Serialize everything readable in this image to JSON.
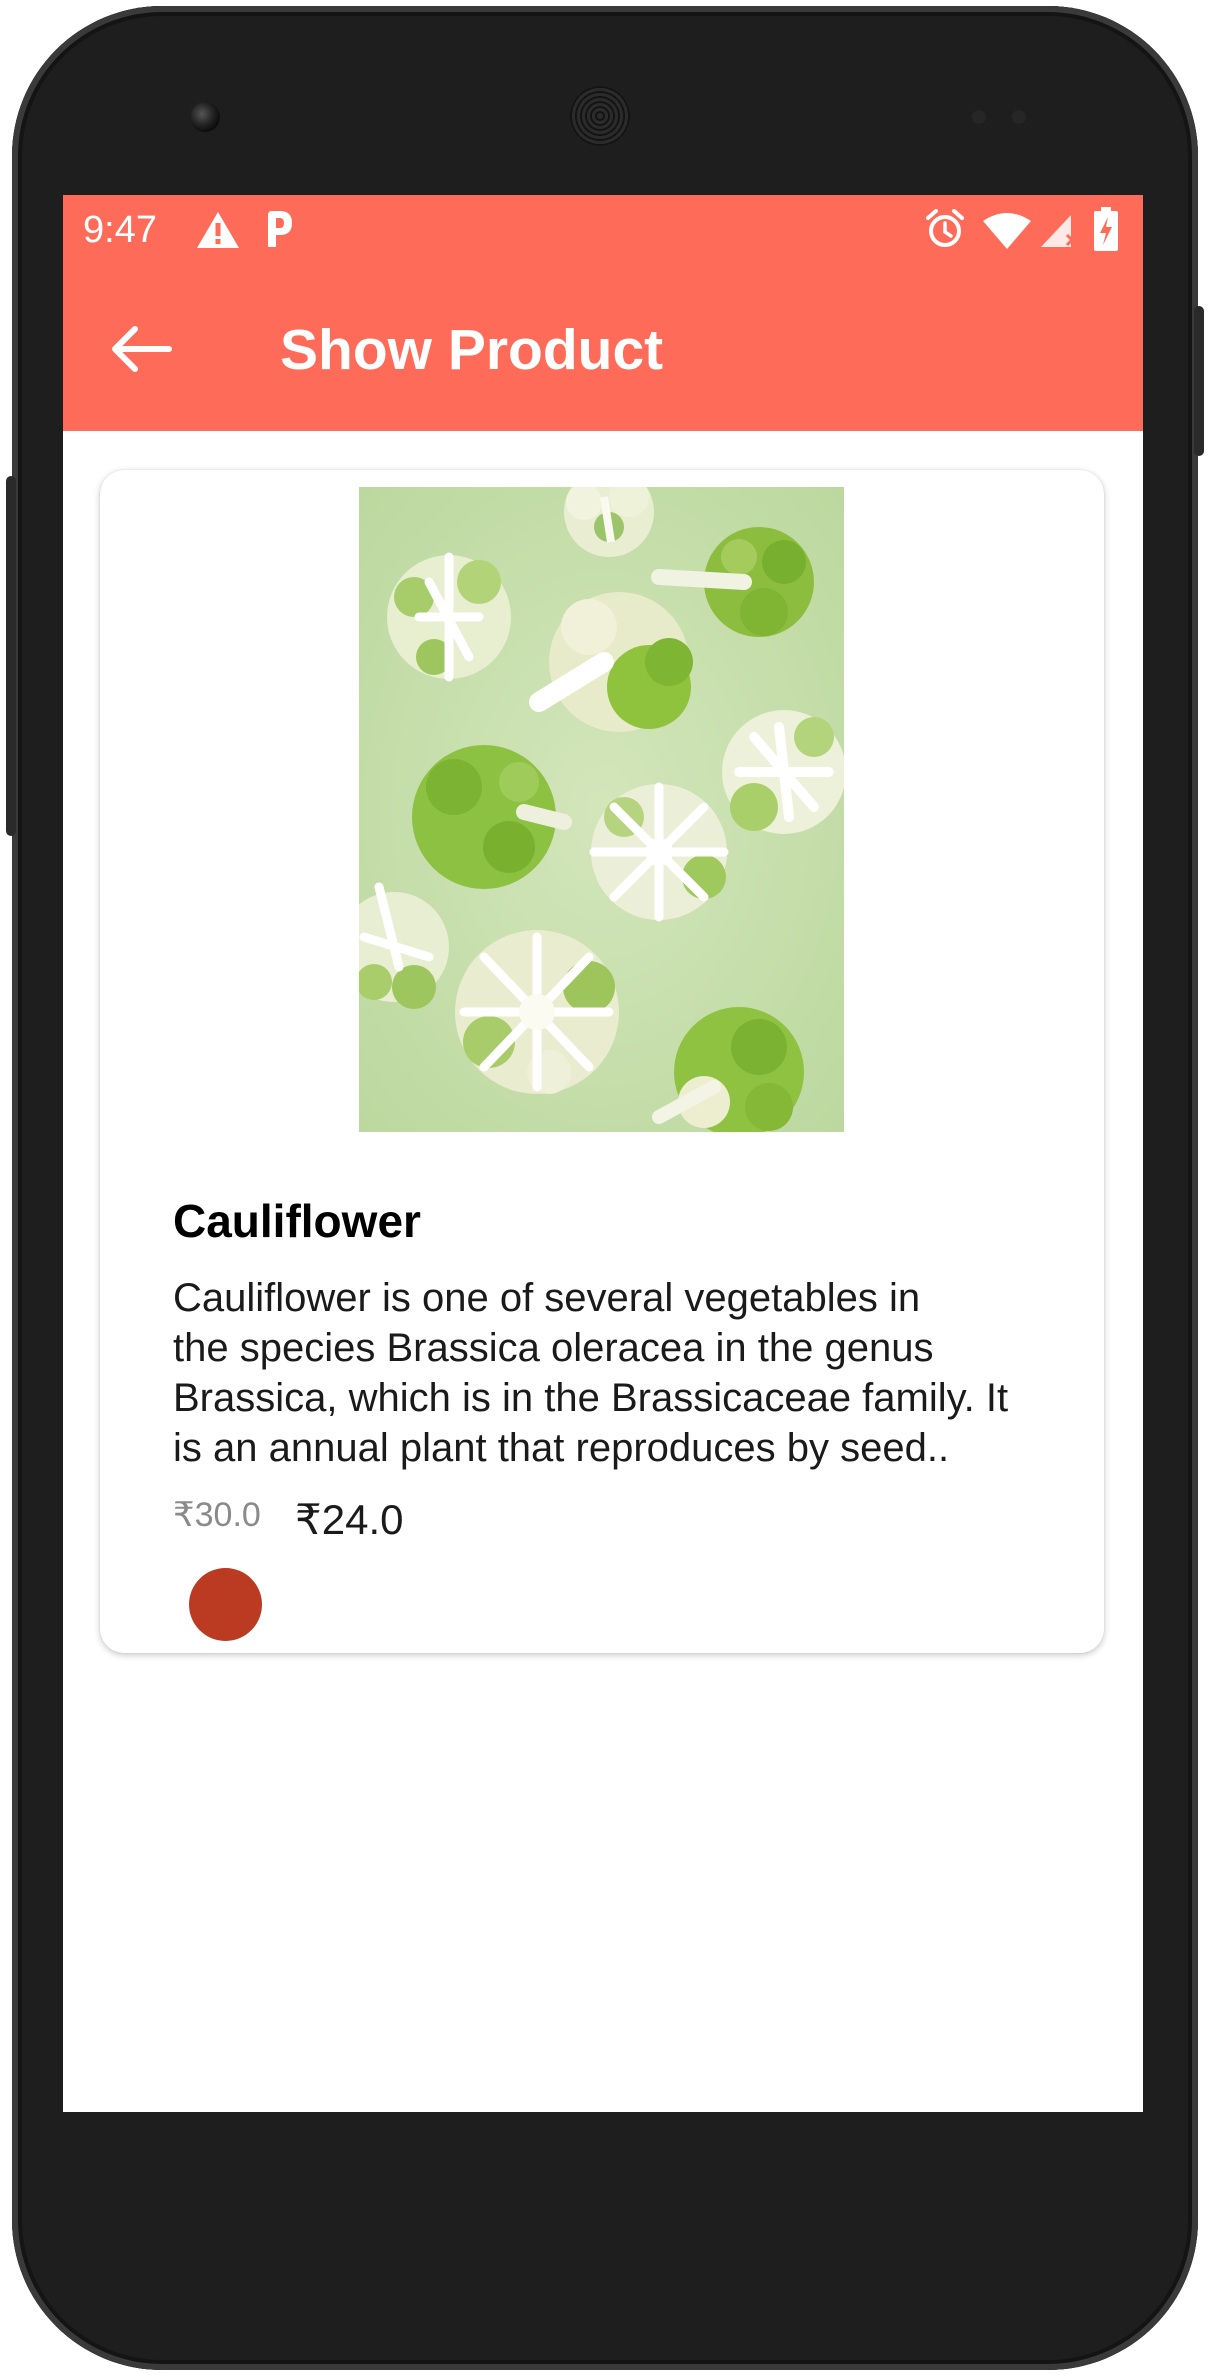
{
  "status_bar": {
    "time": "9:47",
    "left_icons": [
      "warning-icon",
      "parking-icon"
    ],
    "right_icons": [
      "alarm-clock-icon",
      "wifi-icon",
      "cell-signal-icon",
      "battery-charging-icon"
    ]
  },
  "app_bar": {
    "title": "Show Product",
    "back_icon": "arrow-back-icon"
  },
  "product": {
    "name": "Cauliflower",
    "description": "Cauliflower is one of several vegetables in\nthe species Brassica oleracea in the     genus\nBrassica, which is in the Brassicaceae family. It\nis an annual plant that reproduces by seed..",
    "original_price": "₹30.0",
    "price": "₹24.0",
    "color_swatch": "#bb3b22"
  },
  "colors": {
    "accent": "#ff6b59",
    "screen_background": "#ffffff",
    "device_frame": "#1e1e1e"
  }
}
